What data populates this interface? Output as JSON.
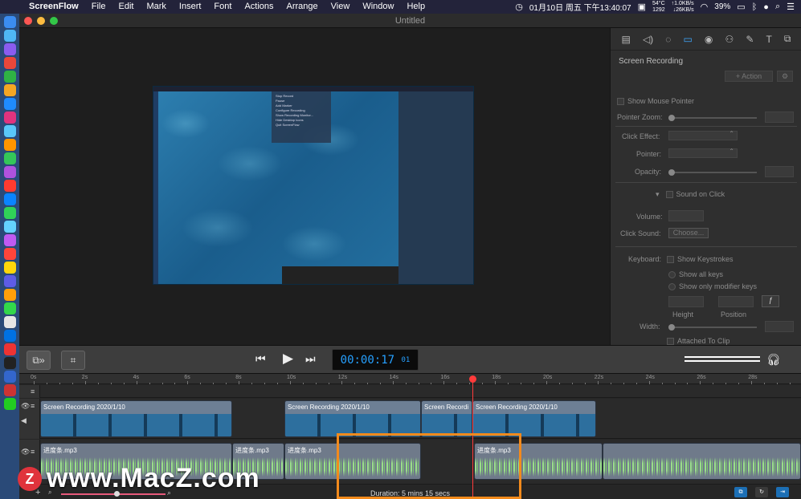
{
  "menubar": {
    "app_name": "ScreenFlow",
    "items": [
      "File",
      "Edit",
      "Mark",
      "Insert",
      "Font",
      "Actions",
      "Arrange",
      "View",
      "Window",
      "Help"
    ],
    "datetime": "01月10日 周五 下午13:40:07",
    "temp": "54°C",
    "rpm": "1292",
    "net_up": "↑1.0KB/s",
    "net_down": "↓26KB/s",
    "battery": "39%"
  },
  "window": {
    "title": "Untitled"
  },
  "preview_menu": {
    "items": [
      "Stop Record",
      "Pause",
      "Add Marker",
      "Configure Recording",
      "Show Recording Monitor...",
      "Hide Desktop Icons",
      "Quit ScreenFlow"
    ]
  },
  "inspector": {
    "section_title": "Screen Recording",
    "action_label": "+ Action",
    "show_mouse_pointer": "Show Mouse Pointer",
    "pointer_zoom": "Pointer Zoom:",
    "click_effect": "Click Effect:",
    "pointer": "Pointer:",
    "opacity": "Opacity:",
    "sound_on_click": "Sound on Click",
    "volume": "Volume:",
    "click_sound": "Click Sound:",
    "choose_label": "Choose...",
    "keyboard": "Keyboard:",
    "show_keystrokes": "Show Keystrokes",
    "show_all_keys": "Show all keys",
    "show_modifier_keys": "Show only modifier keys",
    "height": "Height",
    "position": "Position",
    "width": "Width:",
    "attached_to_clip": "Attached To Clip"
  },
  "transport": {
    "timecode_main": "00:00:17",
    "timecode_frames": "01"
  },
  "timeline": {
    "ruler_labels": [
      "0s",
      "2s",
      "4s",
      "6s",
      "8s",
      "10s",
      "12s",
      "14s",
      "16s",
      "18s",
      "20s",
      "22s",
      "24s",
      "26s",
      "28s"
    ],
    "video_clips": [
      {
        "label": "Screen Recording 2020/1/10"
      },
      {
        "label": "Screen Recording 2020/1/10"
      },
      {
        "label": "Screen Recordi"
      },
      {
        "label": "Screen Recording 2020/1/10"
      }
    ],
    "audio_clips": [
      {
        "label": "进度条.mp3"
      },
      {
        "label": "进度条.mp3"
      },
      {
        "label": "进度条.mp3"
      },
      {
        "label": "进度条.mp3"
      },
      {
        "label": ""
      }
    ],
    "duration": "Duration: 5 mins 15 secs"
  },
  "watermark": {
    "logo_letter": "Z",
    "text": "www.MacZ.com"
  },
  "colors": {
    "accent": "#26a0ff",
    "playhead": "#ff3b3b",
    "highlight": "#f28a1c"
  }
}
